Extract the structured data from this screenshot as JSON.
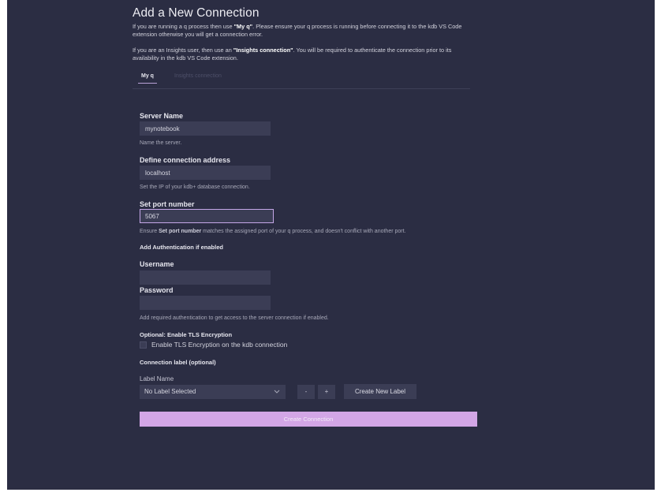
{
  "header": {
    "title": "Add a New Connection",
    "intro1_a": "If you are running a q process then use ",
    "intro1_b": "\"My q\"",
    "intro1_c": ". Please ensure your q process is running before connecting it to the kdb VS Code extension otherwise you will get a connection error.",
    "intro2_a": "If you are an Insights user, then use an ",
    "intro2_b": "\"Insights connection\"",
    "intro2_c": ". You will be required to authenticate the connection prior to its availability in the kdb VS Code extension."
  },
  "tabs": [
    {
      "label": "My q",
      "active": true
    },
    {
      "label": "Insights connection",
      "active": false
    }
  ],
  "form": {
    "server_name_label": "Server Name",
    "server_name_value": "mynotebook",
    "server_name_help": "Name the server.",
    "address_label": "Define connection address",
    "address_value": "localhost",
    "address_help": "Set the IP of your kdb+ database connection.",
    "port_label": "Set port number",
    "port_value": "5067",
    "port_help_a": "Ensure ",
    "port_help_b": "Set port number",
    "port_help_c": " matches the assigned port of your q process, and doesn't conflict with another port.",
    "auth_heading": "Add Authentication if enabled",
    "username_label": "Username",
    "username_value": "",
    "password_label": "Password",
    "password_value": "",
    "auth_help": "Add required authentication to get access to the server connection if enabled.",
    "tls_heading": "Optional: Enable TLS Encryption",
    "tls_checkbox_label": "Enable TLS Encryption on the kdb connection",
    "tls_checked": false,
    "conn_label_heading": "Connection label (optional)",
    "label_name_caption": "Label Name",
    "label_select_value": "No Label Selected",
    "minus_label": "-",
    "plus_label": "+",
    "create_label_button": "Create New Label",
    "create_connection_button": "Create Connection"
  },
  "colors": {
    "panel_bg": "#2b2d43",
    "input_bg": "#3b3d55",
    "accent": "#d3a6e6",
    "focus_border": "#c5a7e8"
  }
}
